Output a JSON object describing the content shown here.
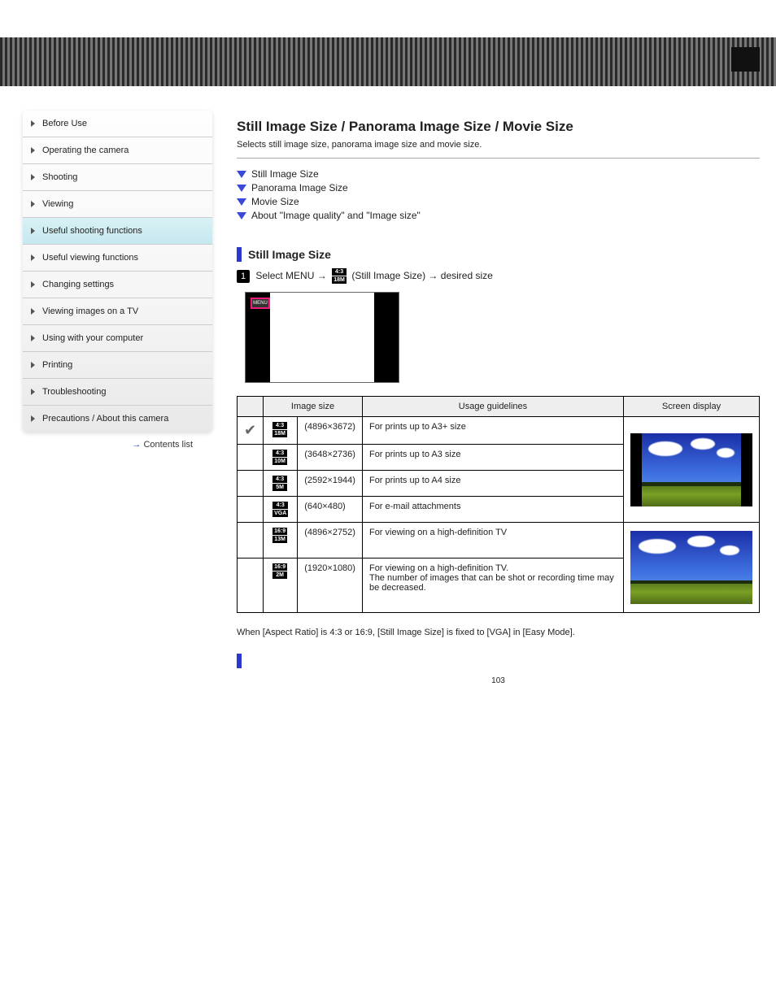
{
  "sidebar": {
    "items": [
      {
        "label": "Before Use"
      },
      {
        "label": "Operating the camera"
      },
      {
        "label": "Shooting"
      },
      {
        "label": "Viewing"
      },
      {
        "label": "Useful shooting functions"
      },
      {
        "label": "Useful viewing functions"
      },
      {
        "label": "Changing settings"
      },
      {
        "label": "Viewing images on a TV"
      },
      {
        "label": "Using with your computer"
      },
      {
        "label": "Printing"
      },
      {
        "label": "Troubleshooting"
      },
      {
        "label": "Precautions / About this camera"
      }
    ],
    "top_link_label": "Contents list",
    "active_index": 4
  },
  "page_title": "Still Image Size / Panorama Image Size / Movie Size",
  "page_subtitle": "Selects still image size, panorama image size and movie size.",
  "toc": [
    "Still Image Size",
    "Panorama Image Size",
    "Movie Size",
    "About \"Image quality\" and \"Image size\""
  ],
  "section_title": "Still Image Size",
  "step_prefix": "Select MENU",
  "step_suffix_a": "(Still Image Size)",
  "step_suffix_b": "desired size",
  "step_icon": {
    "top": "4:3",
    "bottom": "18M"
  },
  "menu_chip_label": "MENU",
  "table": {
    "headers": [
      "",
      "Image size",
      "Usage guidelines",
      "Screen display"
    ],
    "rows": [
      {
        "check": true,
        "icon": {
          "top": "4:3",
          "bottom": "18M"
        },
        "size": "(4896×3672)",
        "usage": "For prints up to A3+ size",
        "thumb": "43"
      },
      {
        "check": false,
        "icon": {
          "top": "4:3",
          "bottom": "10M"
        },
        "size": "(3648×2736)",
        "usage": "For prints up to A3 size",
        "thumb": ""
      },
      {
        "check": false,
        "icon": {
          "top": "4:3",
          "bottom": "5M"
        },
        "size": "(2592×1944)",
        "usage": "For prints up to A4 size",
        "thumb": ""
      },
      {
        "check": false,
        "icon": {
          "top": "4:3",
          "bottom": "VGA"
        },
        "size": "(640×480)",
        "usage": "For e-mail attachments",
        "thumb": ""
      },
      {
        "check": false,
        "icon": {
          "top": "16:9",
          "bottom": "13M"
        },
        "size": "(4896×2752)",
        "usage": "For viewing on a high-definition TV",
        "thumb": "169"
      },
      {
        "check": false,
        "icon": {
          "top": "16:9",
          "bottom": "2M"
        },
        "size": "(1920×1080)",
        "usage": "For viewing on a high-definition TV.\nThe number of images that can be shot or recording time may be decreased.",
        "thumb": ""
      }
    ]
  },
  "footer_note": "When [Aspect Ratio] is 4:3 or 16:9, [Still Image Size] is fixed to [VGA] in [Easy Mode].",
  "page_number": "103"
}
